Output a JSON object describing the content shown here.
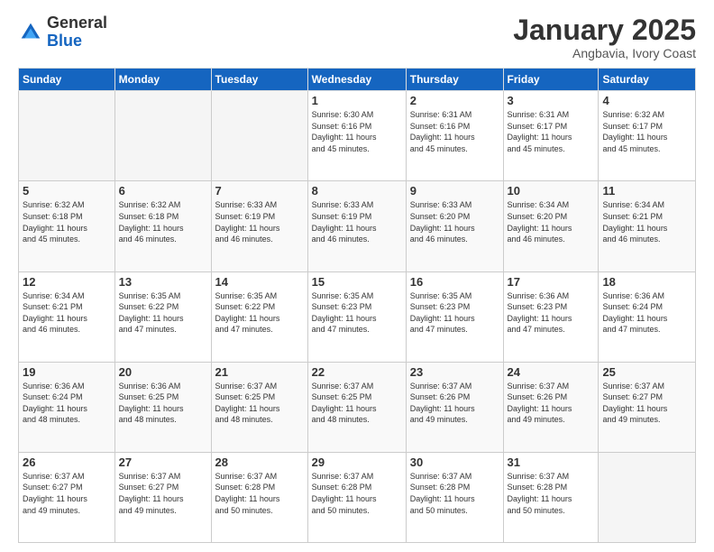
{
  "logo": {
    "general": "General",
    "blue": "Blue"
  },
  "title": {
    "month_year": "January 2025",
    "location": "Angbavia, Ivory Coast"
  },
  "weekdays": [
    "Sunday",
    "Monday",
    "Tuesday",
    "Wednesday",
    "Thursday",
    "Friday",
    "Saturday"
  ],
  "weeks": [
    [
      {
        "day": "",
        "info": ""
      },
      {
        "day": "",
        "info": ""
      },
      {
        "day": "",
        "info": ""
      },
      {
        "day": "1",
        "info": "Sunrise: 6:30 AM\nSunset: 6:16 PM\nDaylight: 11 hours\nand 45 minutes."
      },
      {
        "day": "2",
        "info": "Sunrise: 6:31 AM\nSunset: 6:16 PM\nDaylight: 11 hours\nand 45 minutes."
      },
      {
        "day": "3",
        "info": "Sunrise: 6:31 AM\nSunset: 6:17 PM\nDaylight: 11 hours\nand 45 minutes."
      },
      {
        "day": "4",
        "info": "Sunrise: 6:32 AM\nSunset: 6:17 PM\nDaylight: 11 hours\nand 45 minutes."
      }
    ],
    [
      {
        "day": "5",
        "info": "Sunrise: 6:32 AM\nSunset: 6:18 PM\nDaylight: 11 hours\nand 45 minutes."
      },
      {
        "day": "6",
        "info": "Sunrise: 6:32 AM\nSunset: 6:18 PM\nDaylight: 11 hours\nand 46 minutes."
      },
      {
        "day": "7",
        "info": "Sunrise: 6:33 AM\nSunset: 6:19 PM\nDaylight: 11 hours\nand 46 minutes."
      },
      {
        "day": "8",
        "info": "Sunrise: 6:33 AM\nSunset: 6:19 PM\nDaylight: 11 hours\nand 46 minutes."
      },
      {
        "day": "9",
        "info": "Sunrise: 6:33 AM\nSunset: 6:20 PM\nDaylight: 11 hours\nand 46 minutes."
      },
      {
        "day": "10",
        "info": "Sunrise: 6:34 AM\nSunset: 6:20 PM\nDaylight: 11 hours\nand 46 minutes."
      },
      {
        "day": "11",
        "info": "Sunrise: 6:34 AM\nSunset: 6:21 PM\nDaylight: 11 hours\nand 46 minutes."
      }
    ],
    [
      {
        "day": "12",
        "info": "Sunrise: 6:34 AM\nSunset: 6:21 PM\nDaylight: 11 hours\nand 46 minutes."
      },
      {
        "day": "13",
        "info": "Sunrise: 6:35 AM\nSunset: 6:22 PM\nDaylight: 11 hours\nand 47 minutes."
      },
      {
        "day": "14",
        "info": "Sunrise: 6:35 AM\nSunset: 6:22 PM\nDaylight: 11 hours\nand 47 minutes."
      },
      {
        "day": "15",
        "info": "Sunrise: 6:35 AM\nSunset: 6:23 PM\nDaylight: 11 hours\nand 47 minutes."
      },
      {
        "day": "16",
        "info": "Sunrise: 6:35 AM\nSunset: 6:23 PM\nDaylight: 11 hours\nand 47 minutes."
      },
      {
        "day": "17",
        "info": "Sunrise: 6:36 AM\nSunset: 6:23 PM\nDaylight: 11 hours\nand 47 minutes."
      },
      {
        "day": "18",
        "info": "Sunrise: 6:36 AM\nSunset: 6:24 PM\nDaylight: 11 hours\nand 47 minutes."
      }
    ],
    [
      {
        "day": "19",
        "info": "Sunrise: 6:36 AM\nSunset: 6:24 PM\nDaylight: 11 hours\nand 48 minutes."
      },
      {
        "day": "20",
        "info": "Sunrise: 6:36 AM\nSunset: 6:25 PM\nDaylight: 11 hours\nand 48 minutes."
      },
      {
        "day": "21",
        "info": "Sunrise: 6:37 AM\nSunset: 6:25 PM\nDaylight: 11 hours\nand 48 minutes."
      },
      {
        "day": "22",
        "info": "Sunrise: 6:37 AM\nSunset: 6:25 PM\nDaylight: 11 hours\nand 48 minutes."
      },
      {
        "day": "23",
        "info": "Sunrise: 6:37 AM\nSunset: 6:26 PM\nDaylight: 11 hours\nand 49 minutes."
      },
      {
        "day": "24",
        "info": "Sunrise: 6:37 AM\nSunset: 6:26 PM\nDaylight: 11 hours\nand 49 minutes."
      },
      {
        "day": "25",
        "info": "Sunrise: 6:37 AM\nSunset: 6:27 PM\nDaylight: 11 hours\nand 49 minutes."
      }
    ],
    [
      {
        "day": "26",
        "info": "Sunrise: 6:37 AM\nSunset: 6:27 PM\nDaylight: 11 hours\nand 49 minutes."
      },
      {
        "day": "27",
        "info": "Sunrise: 6:37 AM\nSunset: 6:27 PM\nDaylight: 11 hours\nand 49 minutes."
      },
      {
        "day": "28",
        "info": "Sunrise: 6:37 AM\nSunset: 6:28 PM\nDaylight: 11 hours\nand 50 minutes."
      },
      {
        "day": "29",
        "info": "Sunrise: 6:37 AM\nSunset: 6:28 PM\nDaylight: 11 hours\nand 50 minutes."
      },
      {
        "day": "30",
        "info": "Sunrise: 6:37 AM\nSunset: 6:28 PM\nDaylight: 11 hours\nand 50 minutes."
      },
      {
        "day": "31",
        "info": "Sunrise: 6:37 AM\nSunset: 6:28 PM\nDaylight: 11 hours\nand 50 minutes."
      },
      {
        "day": "",
        "info": ""
      }
    ]
  ]
}
